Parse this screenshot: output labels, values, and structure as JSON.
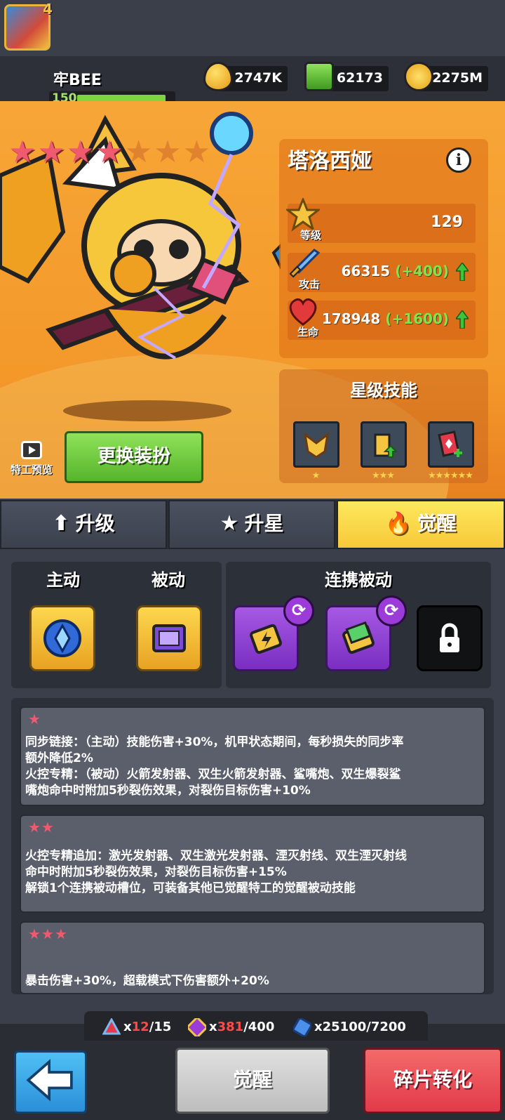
{
  "player": {
    "name": "牢BEE",
    "avatar_level": "4",
    "level": "150",
    "xp_fraction": 0.93
  },
  "resources": [
    {
      "icon": "gold-drop-icon",
      "value": "2747K"
    },
    {
      "icon": "green-gem-icon",
      "value": "62173"
    },
    {
      "icon": "gold-coin-icon",
      "value": "2275M"
    }
  ],
  "hero": {
    "name": "塔洛西娅",
    "stars_filled": 4,
    "stars_total": 7,
    "stats": {
      "level": {
        "label": "等级",
        "value": "129"
      },
      "attack": {
        "label": "攻击",
        "value": "66315",
        "increase": "(+400)"
      },
      "health": {
        "label": "生命",
        "value": "178948",
        "increase": "(+1600)"
      }
    }
  },
  "star_skills": {
    "title": "星级技能",
    "items": [
      {
        "icon": "gold-helmet-icon",
        "stars": "★"
      },
      {
        "icon": "battery-upgrade-icon",
        "stars": "★★★"
      },
      {
        "icon": "red-card-plus-icon",
        "stars": "★★★★★★"
      }
    ]
  },
  "preview_label": "特工预览",
  "costume_button": "更换装扮",
  "tabs": {
    "upgrade": "升级",
    "star_up": "升星",
    "awaken": "觉醒"
  },
  "skills": {
    "active_label": "主动",
    "passive_label": "被动",
    "linked_label": "连携被动"
  },
  "descriptions": [
    {
      "stars": "★",
      "lines": [
        "同步链接：（主动）技能伤害+30%，机甲状态期间，每秒损失的同步率",
        "额外降低2%",
        "火控专精：（被动）火箭发射器、双生火箭发射器、鲨嘴炮、双生爆裂鲨",
        "嘴炮命中时附加5秒裂伤效果，对裂伤目标伤害+10%"
      ]
    },
    {
      "stars": "★★",
      "lines": [
        "火控专精追加：激光发射器、双生激光发射器、湮灭射线、双生湮灭射线",
        "命中时附加5秒裂伤效果，对裂伤目标伤害+15%",
        "解锁1个连携被动槽位，可装备其他已觉醒特工的觉醒被动技能"
      ]
    },
    {
      "stars": "★★★",
      "lines": [
        "暴击伤害+30%，超载模式下伤害额外+20%"
      ]
    }
  ],
  "counters": [
    {
      "icon": "red-triangle-icon",
      "prefix": "x",
      "current": "12",
      "total": "/15"
    },
    {
      "icon": "dna-chip-icon",
      "prefix": "x",
      "current": "381",
      "total": "/400"
    },
    {
      "icon": "blue-puzzle-icon",
      "prefix": "x",
      "current": "25100",
      "total": "/7200"
    }
  ],
  "buttons": {
    "awaken": "觉醒",
    "convert": "碎片转化"
  },
  "colors": {
    "orange_bg": "#f6a637",
    "active_tab": "#fde85d",
    "star_red": "#ef5a6e",
    "increase_green": "#7ee54a"
  }
}
